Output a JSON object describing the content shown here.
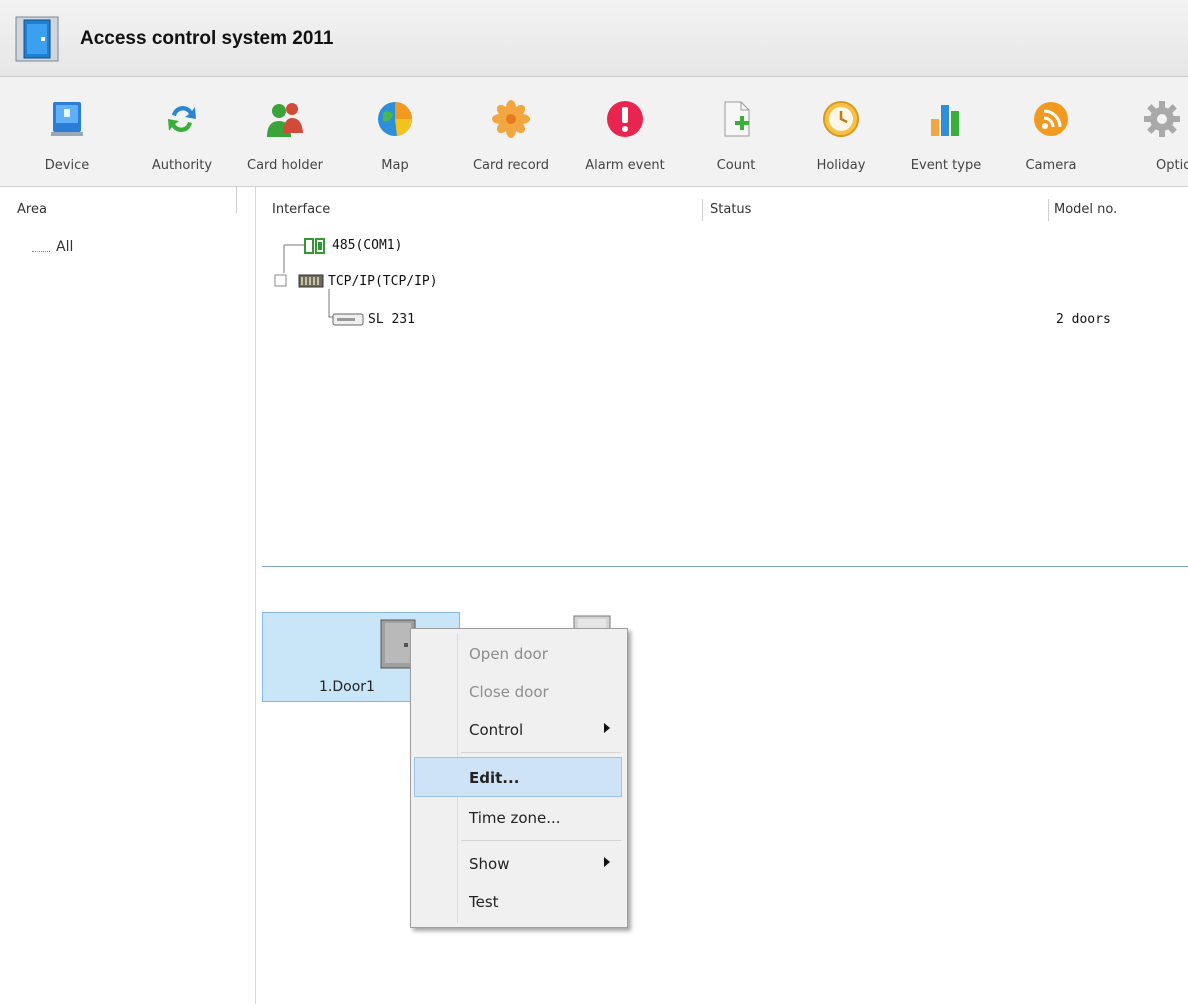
{
  "window": {
    "title": "Access control system 2011"
  },
  "toolbar": {
    "buttons": [
      {
        "label": "Device",
        "icon": "device-icon"
      },
      {
        "label": "Authority",
        "icon": "authority-icon"
      },
      {
        "label": "Card holder",
        "icon": "card-holder-icon"
      },
      {
        "label": "Map",
        "icon": "map-icon"
      },
      {
        "label": "Card record",
        "icon": "card-record-icon"
      },
      {
        "label": "Alarm event",
        "icon": "alarm-icon"
      },
      {
        "label": "Count",
        "icon": "count-icon"
      },
      {
        "label": "Holiday",
        "icon": "holiday-icon"
      },
      {
        "label": "Event type",
        "icon": "event-type-icon"
      },
      {
        "label": "Camera",
        "icon": "camera-icon"
      },
      {
        "label": "Option",
        "icon": "gear-icon"
      }
    ]
  },
  "area_panel": {
    "header": "Area",
    "items": [
      {
        "label": "All"
      }
    ]
  },
  "device_table": {
    "columns": [
      "Interface",
      "Status",
      "Model no."
    ],
    "rows": [
      {
        "interface": "485(COM1)",
        "status": "",
        "model": ""
      },
      {
        "interface": "TCP/IP(TCP/IP)",
        "status": "",
        "model": ""
      },
      {
        "interface": "SL 231",
        "status": "",
        "model": "2 doors"
      }
    ]
  },
  "doors": [
    {
      "label": "1.Door1"
    }
  ],
  "context_menu": {
    "items": [
      {
        "label": "Open door",
        "disabled": true
      },
      {
        "label": "Close door",
        "disabled": true
      },
      {
        "label": "Control",
        "submenu": true
      },
      {
        "label": "Edit...",
        "highlighted": true
      },
      {
        "label": "Time zone..."
      },
      {
        "label": "Show",
        "submenu": true
      },
      {
        "label": "Test"
      }
    ]
  },
  "colors": {
    "selection": "#c8e6f8",
    "menu_highlight": "#cfe3f6",
    "divider": "#7fa6c9"
  }
}
